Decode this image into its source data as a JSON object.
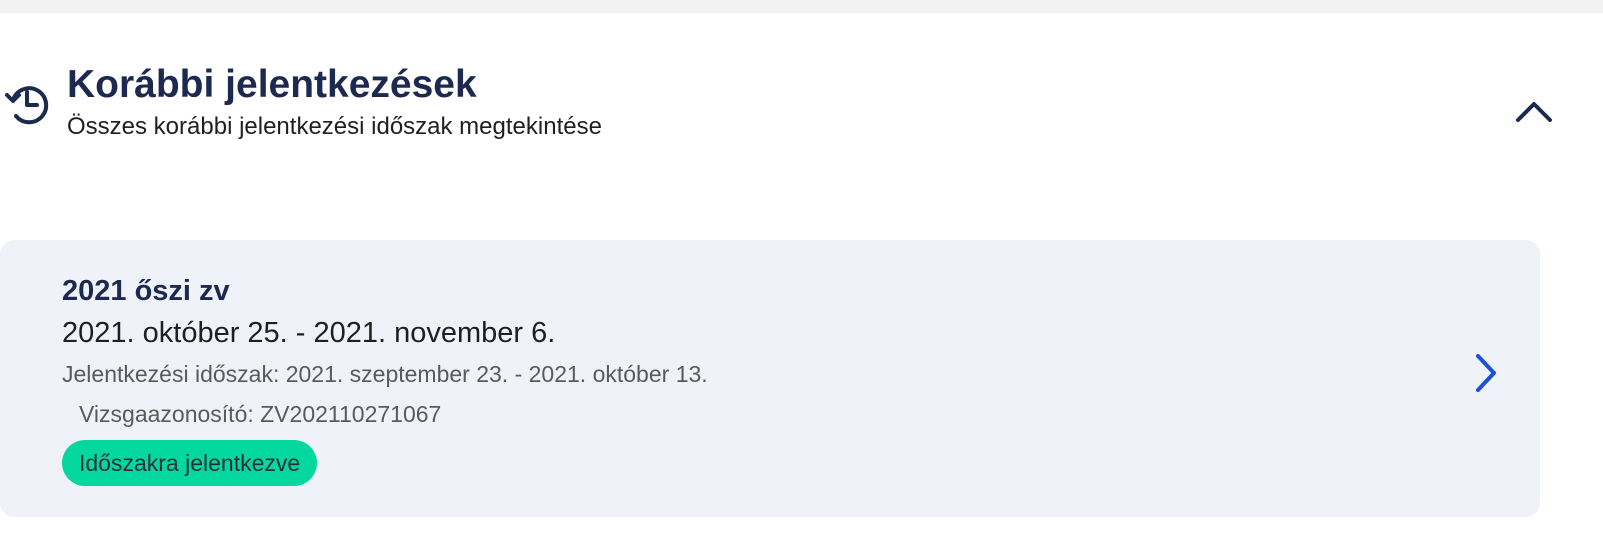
{
  "section": {
    "title": "Korábbi jelentkezések",
    "subtitle": "Összes korábbi jelentkezési időszak megtekintése",
    "icon": "history-icon",
    "toggle_icon": "chevron-up-icon"
  },
  "periods": [
    {
      "title": "2021 őszi zv",
      "exam_dates": "2021. október 25. - 2021. november 6.",
      "registration_period": "Jelentkezési időszak: 2021. szeptember 23. - 2021. október 13.",
      "exam_id": "Vizsgaazonosító: ZV202110271067",
      "status": "Időszakra jelentkezve",
      "status_color": "#05d89e",
      "open_icon": "chevron-right-icon"
    }
  ],
  "colors": {
    "title": "#1c2a4f",
    "card_background": "#f0f2fa",
    "chevron_accent": "#1f4fd6",
    "top_strip": "#f2f2f2"
  }
}
